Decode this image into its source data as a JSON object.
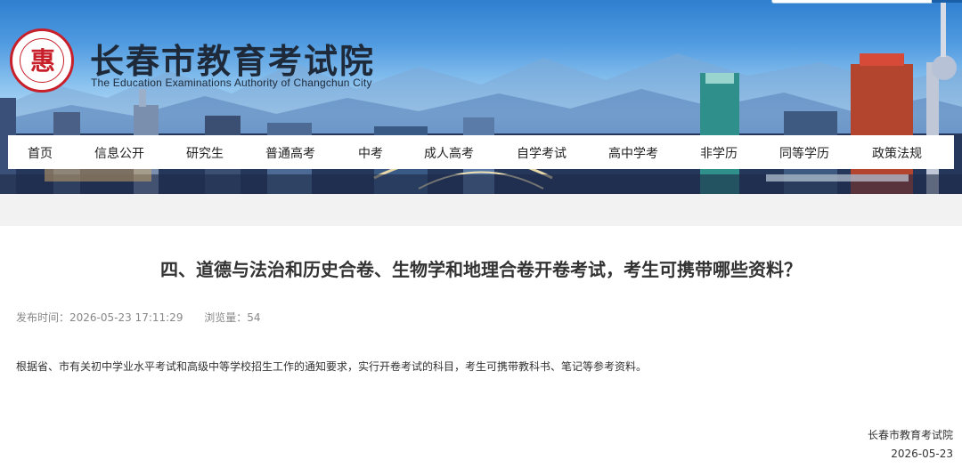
{
  "header": {
    "title": "长春市教育考试院",
    "subtitle": "The Education Examinations Authority of Changchun City",
    "logo_glyph": "惠"
  },
  "colors": {
    "brand_red": "#c8202a",
    "nav_background": "#ffffff",
    "title_text": "#333333"
  },
  "nav": {
    "items": [
      {
        "label": "首页"
      },
      {
        "label": "信息公开"
      },
      {
        "label": "研究生"
      },
      {
        "label": "普通高考"
      },
      {
        "label": "中考"
      },
      {
        "label": "成人高考"
      },
      {
        "label": "自学考试"
      },
      {
        "label": "高中学考"
      },
      {
        "label": "非学历"
      },
      {
        "label": "同等学历"
      },
      {
        "label": "政策法规"
      }
    ]
  },
  "article": {
    "title": "四、道德与法治和历史合卷、生物学和地理合卷开卷考试，考生可携带哪些资料？",
    "published_label": "发布时间：2026-05-23 17:11:29",
    "views_label": "浏览量：54",
    "body": "根据省、市有关初中学业水平考试和高级中等学校招生工作的通知要求，实行开卷考试的科目，考生可携带教科书、笔记等参考资料。",
    "signature_org": "长春市教育考试院",
    "signature_date": "2026-05-23"
  }
}
